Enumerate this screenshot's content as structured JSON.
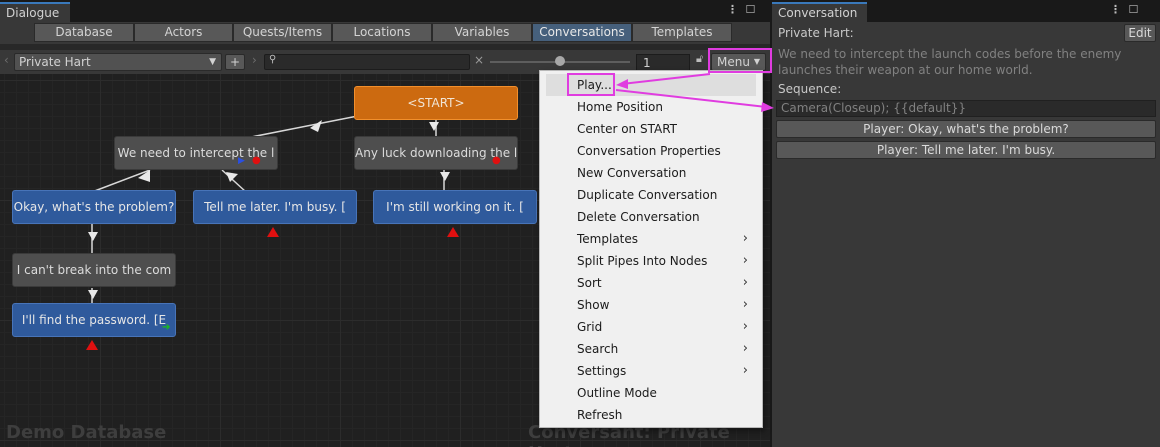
{
  "left_window": {
    "tab_title": "Dialogue",
    "toolbar_tabs": [
      "Database",
      "Actors",
      "Quests/Items",
      "Locations",
      "Variables",
      "Conversations",
      "Templates"
    ],
    "active_tab": "Conversations",
    "conversation_select": "Private Hart",
    "add_label": "+",
    "search_placeholder": "",
    "clear_label": "×",
    "zoom_value": 1,
    "zoom_display": "1",
    "menu_label": "Menu"
  },
  "canvas": {
    "nodes": [
      {
        "type": "start",
        "text": "<START>"
      },
      {
        "type": "npc",
        "text": "We need to intercept the l"
      },
      {
        "type": "npc",
        "text": "Any luck downloading the l"
      },
      {
        "type": "pc",
        "text": "Okay, what's the problem?"
      },
      {
        "type": "pc",
        "text": "Tell me later. I'm busy. ["
      },
      {
        "type": "pc",
        "text": "I'm still working on it. ["
      },
      {
        "type": "npc",
        "text": "I can't break into the com"
      },
      {
        "type": "pc",
        "text": "I'll find the password. [E"
      }
    ],
    "bottom_left_text": "Demo Database",
    "bottom_right_text": "Conversant: Private Hart"
  },
  "context_menu": {
    "items": [
      {
        "label": "Play...",
        "submenu": false
      },
      {
        "label": "Home Position",
        "submenu": false
      },
      {
        "label": "Center on START",
        "submenu": false
      },
      {
        "label": "Conversation Properties",
        "submenu": false
      },
      {
        "label": "New Conversation",
        "submenu": false
      },
      {
        "label": "Duplicate Conversation",
        "submenu": false
      },
      {
        "label": "Delete Conversation",
        "submenu": false
      },
      {
        "label": "Templates",
        "submenu": true
      },
      {
        "label": "Split Pipes Into Nodes",
        "submenu": true
      },
      {
        "label": "Sort",
        "submenu": true
      },
      {
        "label": "Show",
        "submenu": true
      },
      {
        "label": "Grid",
        "submenu": true
      },
      {
        "label": "Search",
        "submenu": true
      },
      {
        "label": "Settings",
        "submenu": true
      },
      {
        "label": "Outline Mode",
        "submenu": false
      },
      {
        "label": "Refresh",
        "submenu": false
      }
    ],
    "highlighted": "Play..."
  },
  "right_window": {
    "tab_title": "Conversation",
    "speaker_label": "Private Hart:",
    "edit_label": "Edit",
    "dialogue_text": "We need to intercept the launch codes before the enemy launches their weapon at our home world.",
    "sequence_label": "Sequence:",
    "sequence_value": "Camera(Closeup); {{default}}",
    "responses": [
      "Player: Okay, what's the problem?",
      "Player: Tell me later. I'm busy."
    ]
  },
  "colors": {
    "accent_tab": "#3a79bb",
    "annotation": "#e03ce0",
    "start_node": "#cc6a10",
    "pc_node": "#2f5a9c",
    "npc_node": "#4e4e4e",
    "warning_triangle": "#e01010"
  }
}
